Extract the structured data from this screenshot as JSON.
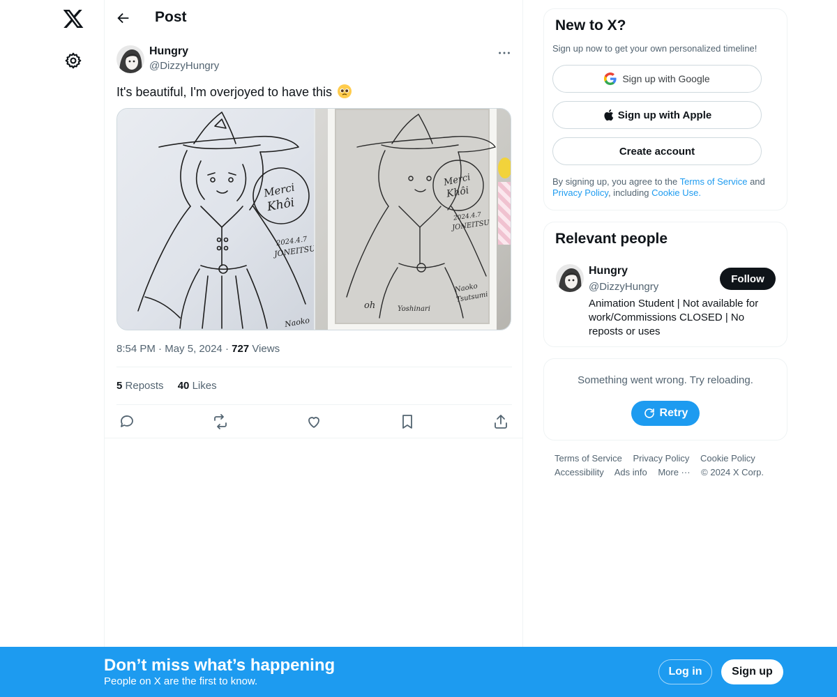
{
  "nav": {
    "logo_icon": "x-logo-icon",
    "settings_icon": "gear-icon"
  },
  "header": {
    "title": "Post"
  },
  "post": {
    "author_name": "Hungry",
    "author_handle": "@DizzyHungry",
    "text": "It's beautiful, I'm overjoyed to have this",
    "emoji": "pleading-face-emoji",
    "photo1_text": {
      "merci": "Merci",
      "khoi": "Khôi",
      "date": "2024.4.7",
      "sign": "JONEITSU",
      "name": "Naoko"
    },
    "photo2_text": {
      "merci": "Merci",
      "khoi": "Khôi",
      "date": "2024.4.7",
      "sign": "JONEITSU",
      "name1": "Naoko",
      "name2": "Tsutsumi",
      "extra1": "oh",
      "extra2": "Yoshinari"
    },
    "time": "8:54 PM",
    "date": "May 5, 2024",
    "views_count": "727",
    "views_label": "Views",
    "reposts_count": "5",
    "reposts_label": "Reposts",
    "likes_count": "40",
    "likes_label": "Likes"
  },
  "signup_card": {
    "title": "New to X?",
    "subtitle": "Sign up now to get your own personalized timeline!",
    "google_label": "Sign up with Google",
    "apple_label": "Sign up with Apple",
    "create_label": "Create account",
    "legal_prefix": "By signing up, you agree to the",
    "terms_link": "Terms of Service",
    "legal_and": "and",
    "privacy_link": "Privacy Policy",
    "legal_including": ", including",
    "cookie_link": "Cookie Use."
  },
  "relevant": {
    "title": "Relevant people",
    "name": "Hungry",
    "handle": "@DizzyHungry",
    "follow_label": "Follow",
    "bio": "Animation Student | Not available for work/Commissions CLOSED | No reposts or uses"
  },
  "error_card": {
    "message": "Something went wrong. Try reloading.",
    "retry_label": "Retry"
  },
  "footer": {
    "links": [
      "Terms of Service",
      "Privacy Policy",
      "Cookie Policy",
      "Accessibility",
      "Ads info",
      "More ···",
      "© 2024 X Corp."
    ]
  },
  "bottom_bar": {
    "title": "Don’t miss what’s happening",
    "subtitle": "People on X are the first to know.",
    "login_label": "Log in",
    "signup_label": "Sign up"
  },
  "colors": {
    "accent": "#1d9bf0",
    "text": "#0f1419",
    "muted": "#536471",
    "border": "#eff3f4"
  }
}
